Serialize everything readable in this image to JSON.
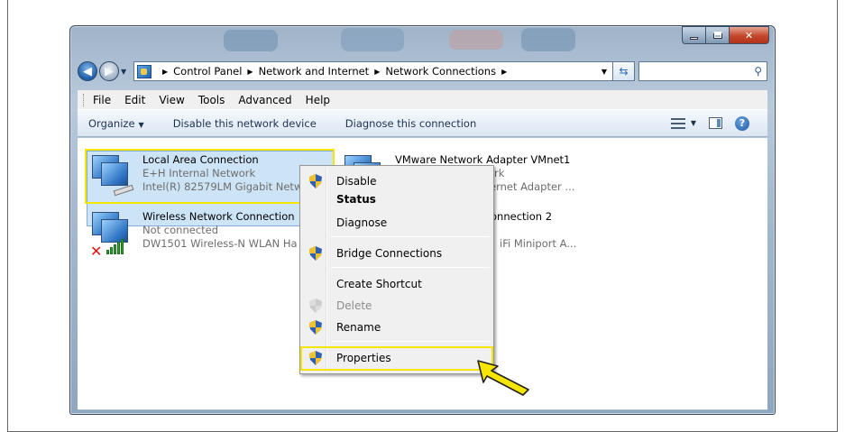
{
  "address": {
    "crumbs": [
      "Control Panel",
      "Network and Internet",
      "Network Connections"
    ]
  },
  "menubar": [
    "File",
    "Edit",
    "View",
    "Tools",
    "Advanced",
    "Help"
  ],
  "commandbar": {
    "organize": "Organize",
    "disable": "Disable this network device",
    "diagnose": "Diagnose this connection"
  },
  "connections": {
    "lan": {
      "name": "Local Area Connection",
      "network": "E+H Internal Network",
      "adapter": "Intel(R) 82579LM Gigabit Netw"
    },
    "wireless": {
      "name": "Wireless Network Connection",
      "status": "Not connected",
      "adapter": "DW1501 Wireless-N WLAN Ha"
    },
    "vmnet": {
      "name": "VMware Network Adapter VMnet1",
      "line2": "rk",
      "line3": "ernet Adapter ..."
    },
    "conn2": {
      "name": "onnection 2",
      "line3": "iFi Miniport A..."
    }
  },
  "context_menu": {
    "disable": "Disable",
    "status": "Status",
    "diagnose": "Diagnose",
    "bridge": "Bridge Connections",
    "shortcut": "Create Shortcut",
    "delete": "Delete",
    "rename": "Rename",
    "properties": "Properties"
  },
  "colors": {
    "highlight": "#f5e600",
    "selection": "#cde4f7"
  }
}
